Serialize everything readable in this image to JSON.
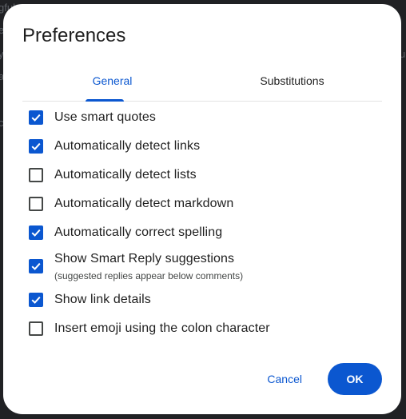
{
  "dialog": {
    "title": "Preferences"
  },
  "tabs": [
    {
      "label": "General",
      "active": true
    },
    {
      "label": "Substitutions",
      "active": false
    }
  ],
  "options": [
    {
      "label": "Use smart quotes",
      "checked": true
    },
    {
      "label": "Automatically detect links",
      "checked": true
    },
    {
      "label": "Automatically detect lists",
      "checked": false
    },
    {
      "label": "Automatically detect markdown",
      "checked": false
    },
    {
      "label": "Automatically correct spelling",
      "checked": true
    },
    {
      "label": "Show Smart Reply suggestions",
      "sublabel": "(suggested replies appear below comments)",
      "checked": true
    },
    {
      "label": "Show link details",
      "checked": true
    },
    {
      "label": "Insert emoji using the colon character",
      "checked": false
    }
  ],
  "actions": {
    "cancel_label": "Cancel",
    "ok_label": "OK"
  },
  "colors": {
    "accent": "#0b57d0",
    "surface": "#ffffff",
    "text": "#1f1f1f"
  },
  "icons": {
    "checkbox_mark": "check-icon"
  }
}
